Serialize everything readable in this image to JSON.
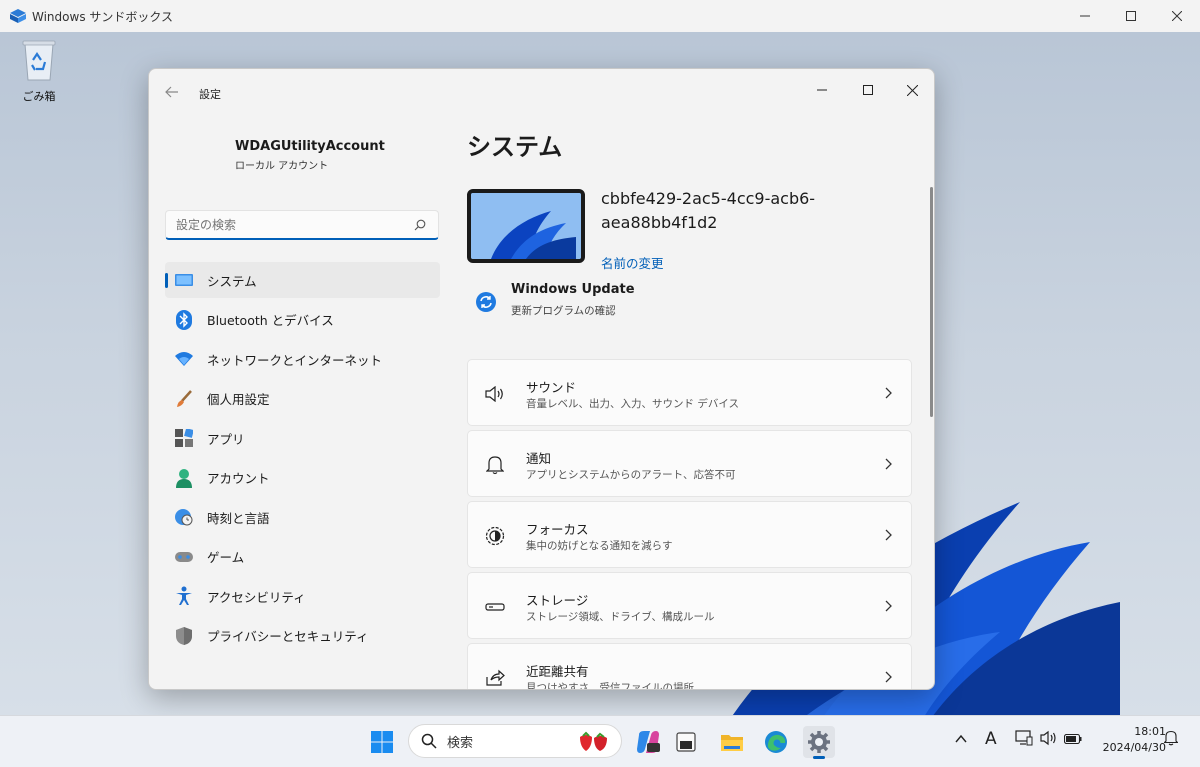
{
  "outer_window": {
    "title": "Windows サンドボックス"
  },
  "desktop": {
    "recycle_bin_label": "ごみ箱"
  },
  "settings": {
    "window_title": "設定",
    "account": {
      "name": "WDAGUtilityAccount",
      "type": "ローカル アカウント"
    },
    "search": {
      "placeholder": "設定の検索"
    },
    "nav": [
      {
        "label": "システム",
        "icon": "monitor-icon",
        "active": true
      },
      {
        "label": "Bluetooth とデバイス",
        "icon": "bluetooth-icon"
      },
      {
        "label": "ネットワークとインターネット",
        "icon": "wifi-icon"
      },
      {
        "label": "個人用設定",
        "icon": "brush-icon"
      },
      {
        "label": "アプリ",
        "icon": "apps-icon"
      },
      {
        "label": "アカウント",
        "icon": "account-icon"
      },
      {
        "label": "時刻と言語",
        "icon": "globe-clock-icon"
      },
      {
        "label": "ゲーム",
        "icon": "gamepad-icon"
      },
      {
        "label": "アクセシビリティ",
        "icon": "accessibility-icon"
      },
      {
        "label": "プライバシーとセキュリティ",
        "icon": "shield-icon"
      }
    ],
    "main": {
      "title": "システム",
      "device_name": "cbbfe429-2ac5-4cc9-acb6-aea88bb4f1d2",
      "rename_link": "名前の変更",
      "windows_update": {
        "title": "Windows Update",
        "subtitle": "更新プログラムの確認"
      },
      "cards": [
        {
          "title": "サウンド",
          "subtitle": "音量レベル、出力、入力、サウンド デバイス",
          "icon": "speaker-icon"
        },
        {
          "title": "通知",
          "subtitle": "アプリとシステムからのアラート、応答不可",
          "icon": "bell-icon"
        },
        {
          "title": "フォーカス",
          "subtitle": "集中の妨げとなる通知を減らす",
          "icon": "focus-icon"
        },
        {
          "title": "ストレージ",
          "subtitle": "ストレージ領域、ドライブ、構成ルール",
          "icon": "drive-icon"
        },
        {
          "title": "近距離共有",
          "subtitle": "見つけやすさ、受信ファイルの場所",
          "icon": "share-icon"
        }
      ]
    }
  },
  "taskbar": {
    "search_label": "検索",
    "ime_indicator": "A",
    "time": "18:01",
    "date": "2024/04/30"
  },
  "colors": {
    "accent": "#005fb8",
    "window_bg": "#f3f3f3",
    "card_bg": "#fbfbfb"
  }
}
